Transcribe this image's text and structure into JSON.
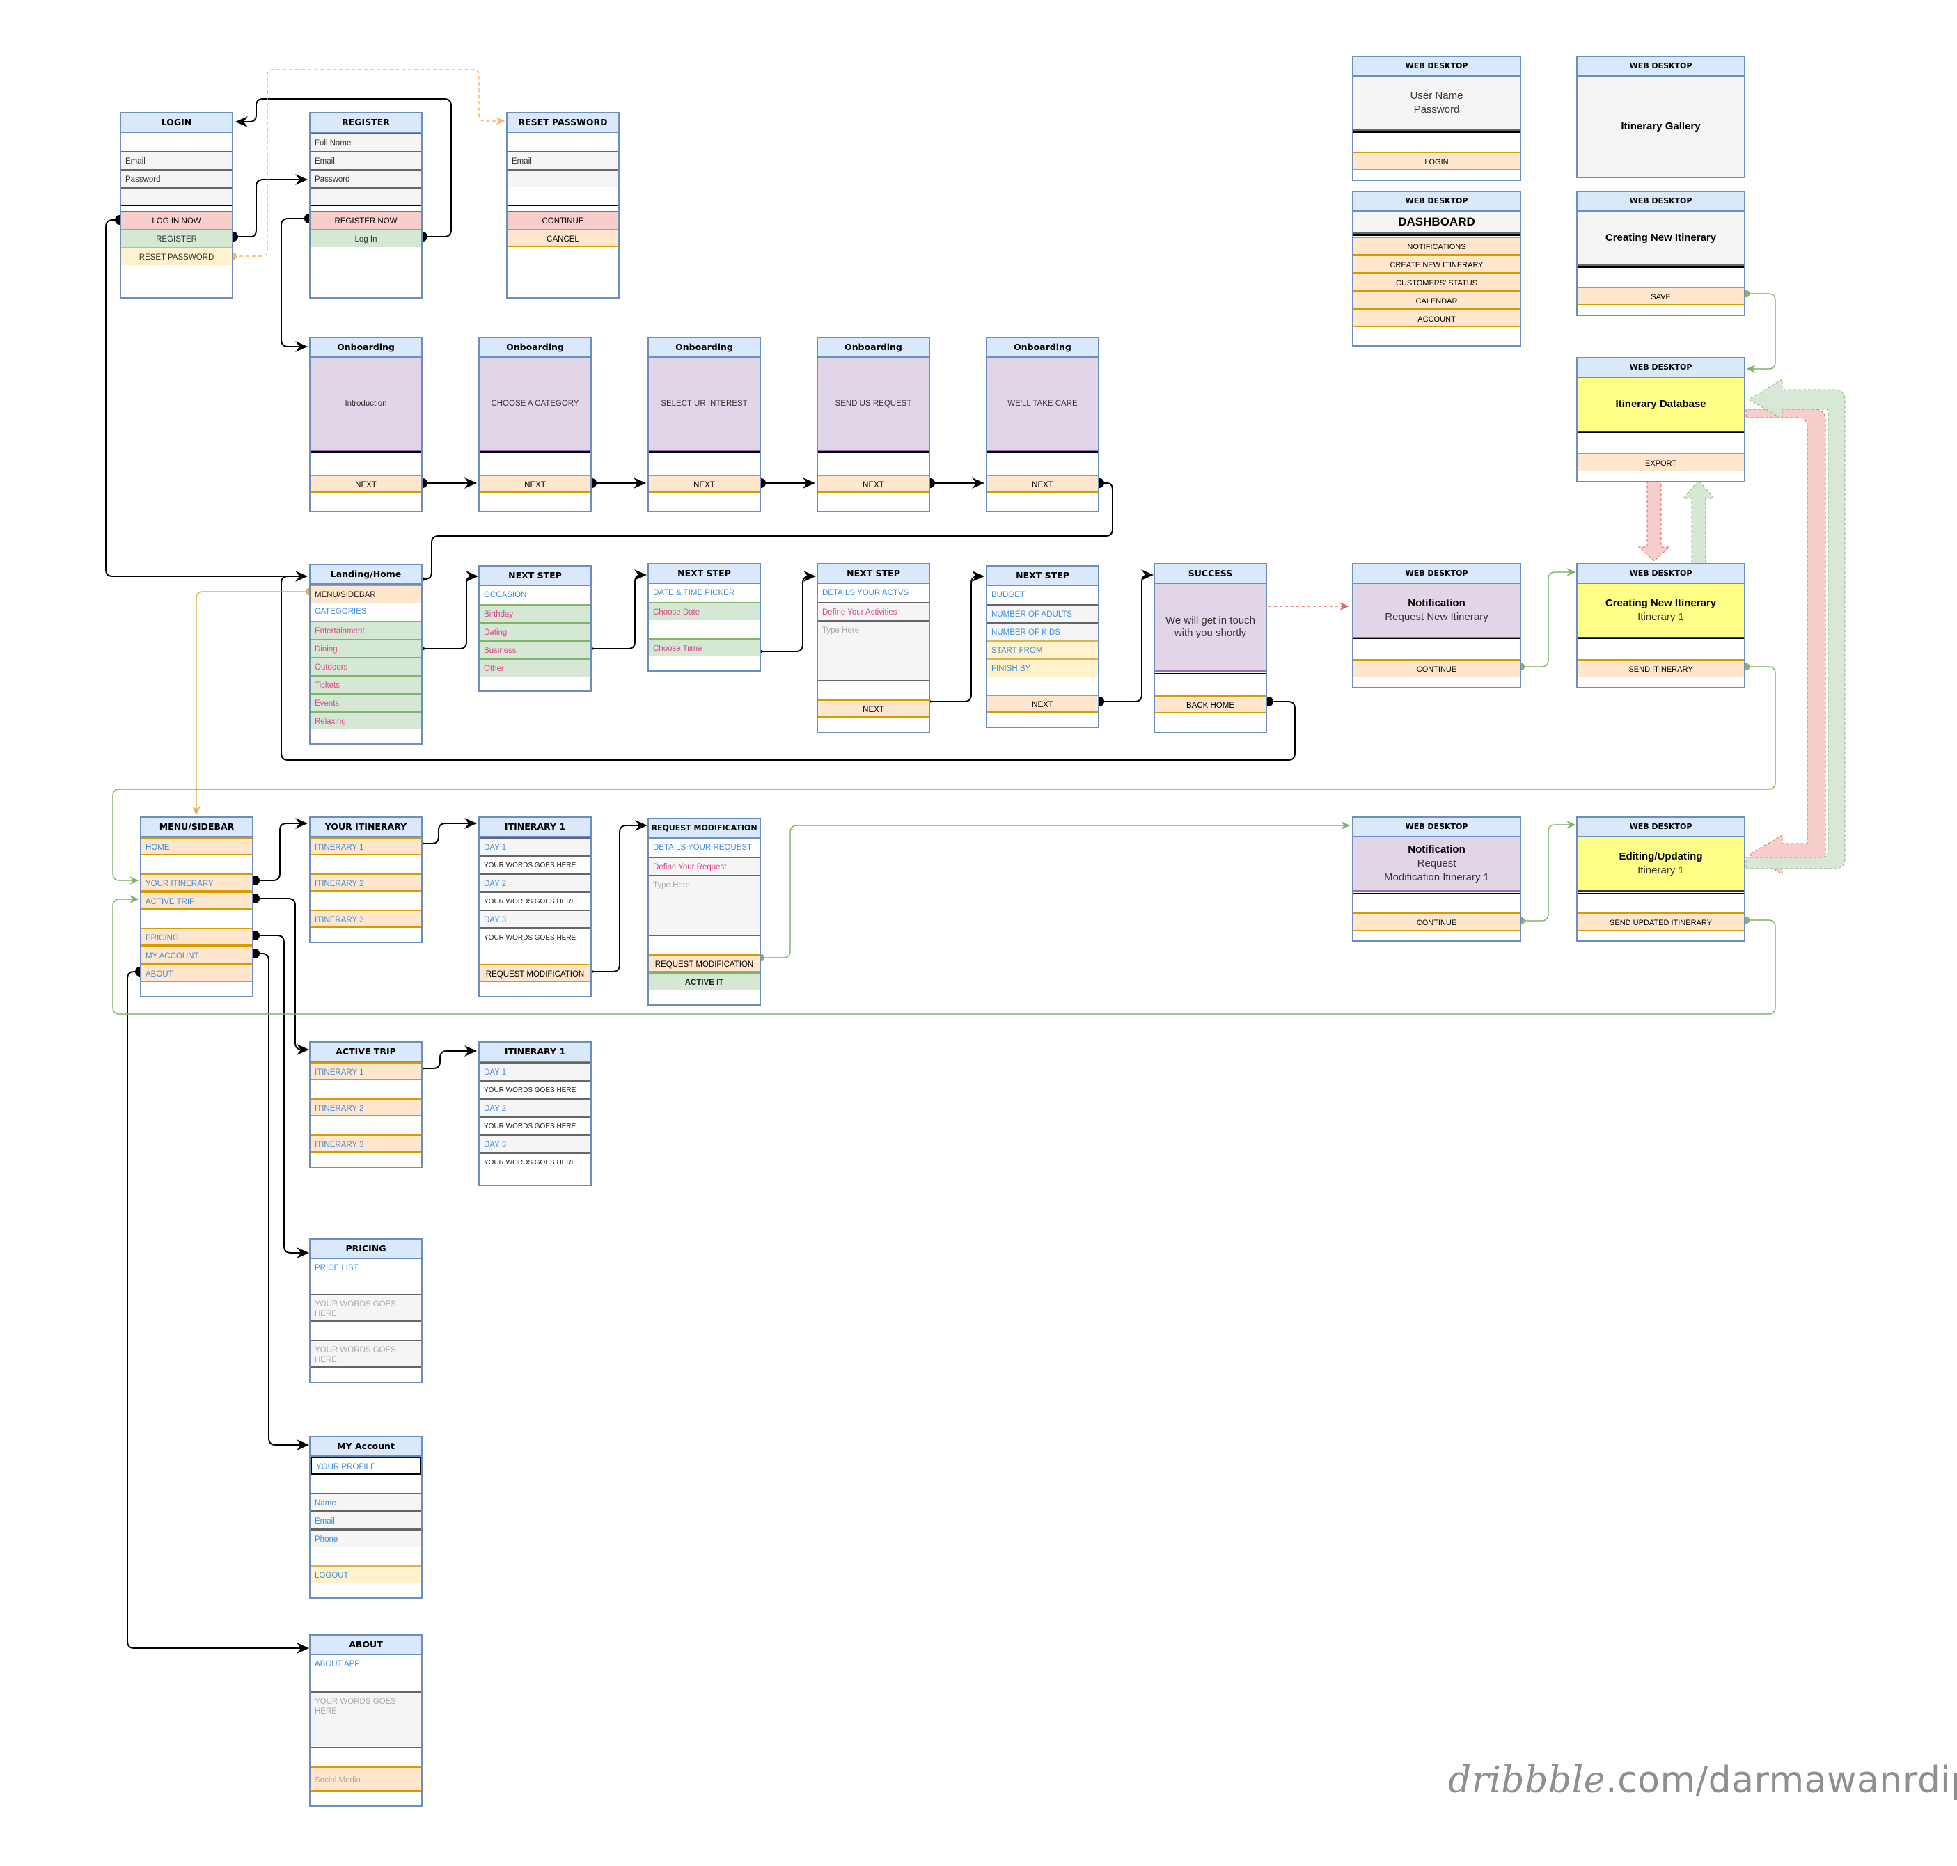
{
  "screens": {
    "login": {
      "title": "LOGIN",
      "rows": [
        {
          "t": "",
          "s": "blank"
        },
        {
          "t": "Email",
          "s": "field"
        },
        {
          "t": "Password",
          "s": "field"
        },
        {
          "t": "",
          "s": "field"
        },
        {
          "t": "",
          "s": "sep"
        },
        {
          "t": "LOG IN NOW",
          "s": "red",
          "btn": true
        },
        {
          "t": "REGISTER",
          "s": "green",
          "btn": true
        },
        {
          "t": "RESET PASSWORD",
          "s": "yellow",
          "btn": true
        },
        {
          "t": "",
          "s": "blank"
        }
      ]
    },
    "register": {
      "title": "REGISTER",
      "rows": [
        {
          "t": "Full Name",
          "s": "field"
        },
        {
          "t": "Email",
          "s": "field"
        },
        {
          "t": "Password",
          "s": "field"
        },
        {
          "t": "",
          "s": "field"
        },
        {
          "t": "",
          "s": "sep"
        },
        {
          "t": "REGISTER NOW",
          "s": "red",
          "btn": true
        },
        {
          "t": "Log In",
          "s": "green",
          "btn": true
        },
        {
          "t": "",
          "s": "blank"
        },
        {
          "t": "",
          "s": "blank"
        }
      ]
    },
    "reset_password": {
      "title": "RESET PASSWORD",
      "rows": [
        {
          "t": "",
          "s": "blank"
        },
        {
          "t": "Email",
          "s": "field"
        },
        {
          "t": "",
          "s": "field-noline"
        },
        {
          "t": "",
          "s": "blank"
        },
        {
          "t": "",
          "s": "sep"
        },
        {
          "t": "CONTINUE",
          "s": "red",
          "btn": true
        },
        {
          "t": "CANCEL",
          "s": "orange",
          "btn": true
        },
        {
          "t": "",
          "s": "blank"
        },
        {
          "t": "",
          "s": "blank"
        }
      ]
    },
    "onboarding_1": {
      "title": "Onboarding",
      "panel": "Introduction",
      "button": "NEXT"
    },
    "onboarding_2": {
      "title": "Onboarding",
      "panel": "CHOOSE A CATEGORY",
      "button": "NEXT"
    },
    "onboarding_3": {
      "title": "Onboarding",
      "panel": "SELECT UR INTEREST",
      "button": "NEXT"
    },
    "onboarding_4": {
      "title": "Onboarding",
      "panel": "SEND US REQUEST",
      "button": "NEXT"
    },
    "onboarding_5": {
      "title": "Onboarding",
      "panel": "WE'LL TAKE CARE",
      "button": "NEXT"
    },
    "landing": {
      "title": "Landing/Home",
      "rows": [
        {
          "t": "MENU/SIDEBAR",
          "s": "orange-dark",
          "btn": true
        },
        {
          "t": "CATEGORIES",
          "s": "blue"
        },
        {
          "t": "Entertainment",
          "s": "pink-green",
          "btn": true
        },
        {
          "t": "Dining",
          "s": "pink-green",
          "btn": true
        },
        {
          "t": "Outdoors",
          "s": "pink-green",
          "btn": true
        },
        {
          "t": "Tickets",
          "s": "pink-green",
          "btn": true
        },
        {
          "t": "Events",
          "s": "pink-green",
          "btn": true
        },
        {
          "t": "Relaxing",
          "s": "pink-green",
          "btn": true
        }
      ]
    },
    "step_occasion": {
      "title": "NEXT STEP",
      "rows": [
        {
          "t": "OCCASION",
          "s": "blue"
        },
        {
          "t": "Birthday",
          "s": "pink-green",
          "btn": true
        },
        {
          "t": "Dating",
          "s": "pink-green",
          "btn": true
        },
        {
          "t": "Business",
          "s": "pink-green",
          "btn": true
        },
        {
          "t": "Other",
          "s": "pink-green",
          "btn": true
        }
      ]
    },
    "step_datetime": {
      "title": "NEXT STEP",
      "rows": [
        {
          "t": "DATE & TIME PICKER",
          "s": "blue"
        },
        {
          "t": "Choose Date",
          "s": "pink-green",
          "btn": true
        },
        {
          "t": "",
          "s": "blank-line"
        },
        {
          "t": "Choose Tiime",
          "s": "pink-green",
          "btn": true
        }
      ]
    },
    "step_activities": {
      "title": "NEXT STEP",
      "rows": [
        {
          "t": "DETAILS YOUR ACTVS",
          "s": "blue"
        },
        {
          "t": "Define Your Activities",
          "s": "pink-field"
        },
        {
          "t": "Type Here",
          "s": "greybox",
          "input": true,
          "h": 88
        },
        {
          "t": "",
          "s": "blank"
        },
        {
          "t": "NEXT",
          "s": "orange",
          "btn": true
        }
      ]
    },
    "step_budget": {
      "title": "NEXT STEP",
      "rows": [
        {
          "t": "BUDGET",
          "s": "blue"
        },
        {
          "t": "NUMBER OF ADULTS",
          "s": "blue-field",
          "input": true
        },
        {
          "t": "NUMBER OF KIDS",
          "s": "blue-field",
          "input": true
        },
        {
          "t": "START FROM",
          "s": "blue-yellow",
          "input": true
        },
        {
          "t": "FINISH BY",
          "s": "blue-yellow",
          "input": true
        },
        {
          "t": "",
          "s": "blank-line"
        },
        {
          "t": "NEXT",
          "s": "orange",
          "btn": true
        }
      ]
    },
    "success": {
      "title": "SUCCESS",
      "panel": "We will get in touch with you shortly",
      "button": "BACK HOME"
    },
    "menu_sidebar": {
      "title": "MENU/SIDEBAR",
      "rows": [
        {
          "t": "HOME",
          "s": "orange-l",
          "btn": true
        },
        {
          "t": "",
          "s": "blank"
        },
        {
          "t": "YOUR ITINERARY",
          "s": "orange-l",
          "btn": true
        },
        {
          "t": "ACTIVE TRIP",
          "s": "orange-l",
          "btn": true
        },
        {
          "t": "",
          "s": "blank"
        },
        {
          "t": "PRICING",
          "s": "orange-l",
          "btn": true
        },
        {
          "t": "MY ACCOUNT",
          "s": "orange-l",
          "btn": true
        },
        {
          "t": "ABOUT",
          "s": "orange-l",
          "btn": true
        }
      ]
    },
    "your_itinerary": {
      "title": "YOUR ITINERARY",
      "rows": [
        {
          "t": "ITINERARY 1",
          "s": "orange-l",
          "btn": true
        },
        {
          "t": "",
          "s": "blank"
        },
        {
          "t": "ITINERARY 2",
          "s": "orange-l",
          "btn": true
        },
        {
          "t": "",
          "s": "blank"
        },
        {
          "t": "ITINERARY 3",
          "s": "orange-l",
          "btn": true
        }
      ]
    },
    "itinerary_1": {
      "title": "ITINERARY 1",
      "rows": [
        {
          "t": "DAY 1",
          "s": "blue-field"
        },
        {
          "t": "YOUR WORDS GOES HERE",
          "s": "text-small"
        },
        {
          "t": "DAY 2",
          "s": "blue-field"
        },
        {
          "t": "YOUR WORDS GOES HERE",
          "s": "text-small"
        },
        {
          "t": "DAY 3",
          "s": "blue-field"
        },
        {
          "t": "YOUR WORDS GOES HERE",
          "s": "text-small"
        },
        {
          "t": "",
          "s": "blank"
        },
        {
          "t": "REQUEST MODIFICATION",
          "s": "orange",
          "btn": true
        }
      ]
    },
    "request_modification": {
      "title": "REQUEST MODIFICATION",
      "rows": [
        {
          "t": "DETAILS YOUR REQUEST",
          "s": "blue"
        },
        {
          "t": "Define Your Request",
          "s": "pink-field"
        },
        {
          "t": "Type Here",
          "s": "greybox",
          "input": true,
          "h": 88
        },
        {
          "t": "",
          "s": "blank"
        },
        {
          "t": "REQUEST MODIFICATION",
          "s": "orange",
          "btn": true
        },
        {
          "t": "ACTIVE IT",
          "s": "bold-green",
          "btn": true
        }
      ]
    },
    "active_trip": {
      "title": "ACTIVE TRIP",
      "rows": [
        {
          "t": "ITINERARY 1",
          "s": "orange-l",
          "btn": true
        },
        {
          "t": "",
          "s": "blank"
        },
        {
          "t": "ITINERARY 2",
          "s": "orange-l",
          "btn": true
        },
        {
          "t": "",
          "s": "blank"
        },
        {
          "t": "ITINERARY 3",
          "s": "orange-l",
          "btn": true
        }
      ]
    },
    "active_itinerary_1": {
      "title": "ITINERARY 1",
      "rows": [
        {
          "t": "DAY 1",
          "s": "blue-field"
        },
        {
          "t": "YOUR WORDS GOES HERE",
          "s": "text-small"
        },
        {
          "t": "DAY 2",
          "s": "blue-field"
        },
        {
          "t": "YOUR WORDS GOES HERE",
          "s": "text-small"
        },
        {
          "t": "DAY 3",
          "s": "blue-field"
        },
        {
          "t": "YOUR WORDS GOES HERE",
          "s": "text-small"
        }
      ]
    },
    "pricing": {
      "title": "PRICING",
      "rows": [
        {
          "t": "PRICE LIST",
          "s": "blue",
          "h": 50
        },
        {
          "t": "YOUR WORDS GOES HERE",
          "s": "greybox",
          "h": 40
        },
        {
          "t": "",
          "s": "blank"
        },
        {
          "t": "YOUR WORDS GOES HERE",
          "s": "greybox",
          "h": 40
        }
      ]
    },
    "my_account": {
      "title": "MY Account",
      "rows": [
        {
          "t": "YOUR PROFILE",
          "s": "blue-outline"
        },
        {
          "t": "",
          "s": "blank"
        },
        {
          "t": "Name",
          "s": "blue-field",
          "input": true
        },
        {
          "t": "Email",
          "s": "blue-field",
          "input": true
        },
        {
          "t": "Phone",
          "s": "blue-field",
          "input": true
        },
        {
          "t": "",
          "s": "blank"
        },
        {
          "t": "LOGOUT",
          "s": "blue-yellow",
          "btn": true
        }
      ]
    },
    "about": {
      "title": "ABOUT",
      "rows": [
        {
          "t": "ABOUT APP",
          "s": "blue",
          "h": 52
        },
        {
          "t": "YOUR WORDS GOES HERE",
          "s": "greybox",
          "h": 82
        },
        {
          "t": "",
          "s": "blank"
        },
        {
          "t": "Social Media",
          "s": "orange-grey",
          "btn": true
        }
      ]
    }
  },
  "web_desktop": {
    "header": "WEB DESKTOP",
    "login": {
      "panel_lines": [
        "User Name",
        "Password"
      ],
      "button": "LOGIN"
    },
    "gallery": {
      "panel_title": "Itinerary Gallery"
    },
    "dashboard": {
      "title": "DASHBOARD",
      "items": [
        "NOTIFICATIONS",
        "CREATE NEW ITINERARY",
        "CUSTOMERS' STATUS",
        "CALENDAR",
        "ACCOUNT"
      ]
    },
    "creating_new": {
      "panel_title": "Creating New Itinerary",
      "button": "SAVE"
    },
    "database": {
      "panel_title": "Itinerary Database",
      "button": "EXPORT"
    },
    "notification_new": {
      "panel_title": "Notification",
      "panel_sub": "Request New Itinerary",
      "button": "CONTINUE"
    },
    "creating_itinerary_1": {
      "panel_title": "Creating New Itinerary",
      "panel_sub": "Itinerary 1",
      "button": "SEND ITINERARY"
    },
    "notification_mod": {
      "panel_title": "Notification",
      "panel_sub": "Request\nModification Itinerary 1",
      "button": "CONTINUE"
    },
    "editing": {
      "panel_title": "Editing/Updating",
      "panel_sub": "Itinerary 1",
      "button": "SEND UPDATED ITINERARY"
    }
  },
  "watermark": {
    "brand": "dribbble",
    "suffix": ".com/darmawanrdipo"
  },
  "colors": {
    "header_fill": "#dae8fc",
    "button_fill": "#ffe6cc",
    "accent_blue": "#3d8fe0",
    "accent_pink": "#e0458f",
    "panel_purple": "#e1d5e7",
    "panel_yellow": "#ffff88"
  }
}
